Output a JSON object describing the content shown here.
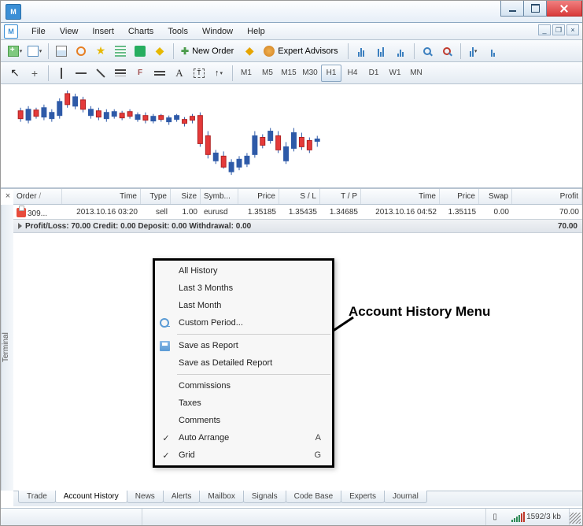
{
  "menu": {
    "file": "File",
    "view": "View",
    "insert": "Insert",
    "charts": "Charts",
    "tools": "Tools",
    "window": "Window",
    "help": "Help"
  },
  "toolbar": {
    "new_order": "New Order",
    "expert_advisors": "Expert Advisors"
  },
  "timeframes": [
    "M1",
    "M5",
    "M15",
    "M30",
    "H1",
    "H4",
    "D1",
    "W1",
    "MN"
  ],
  "active_timeframe": "H1",
  "grid": {
    "headers": {
      "order": "Order",
      "time": "Time",
      "type": "Type",
      "size": "Size",
      "symbol": "Symb...",
      "price": "Price",
      "sl": "S / L",
      "tp": "T / P",
      "time2": "Time",
      "price2": "Price",
      "swap": "Swap",
      "profit": "Profit"
    },
    "sort_indicator": "/",
    "row": {
      "order": "309...",
      "time": "2013.10.16 03:20",
      "type": "sell",
      "size": "1.00",
      "symbol": "eurusd",
      "price": "1.35185",
      "sl": "1.35435",
      "tp": "1.34685",
      "time2": "2013.10.16 04:52",
      "price2": "1.35115",
      "swap": "0.00",
      "profit": "70.00"
    },
    "summary": {
      "text": "Profit/Loss: 70.00  Credit: 0.00  Deposit: 0.00  Withdrawal: 0.00",
      "total": "70.00"
    }
  },
  "terminal_label": "Terminal",
  "tabs": [
    "Trade",
    "Account History",
    "News",
    "Alerts",
    "Mailbox",
    "Signals",
    "Code Base",
    "Experts",
    "Journal"
  ],
  "active_tab": "Account History",
  "context_menu": {
    "all_history": "All History",
    "last_3_months": "Last 3 Months",
    "last_month": "Last Month",
    "custom_period": "Custom Period...",
    "save_report": "Save as Report",
    "save_detailed": "Save as Detailed Report",
    "commissions": "Commissions",
    "taxes": "Taxes",
    "comments": "Comments",
    "auto_arrange": "Auto Arrange",
    "auto_arrange_key": "A",
    "grid": "Grid",
    "grid_key": "G"
  },
  "annotation": "Account History Menu",
  "status": {
    "transfer": "1592/3 kb"
  }
}
